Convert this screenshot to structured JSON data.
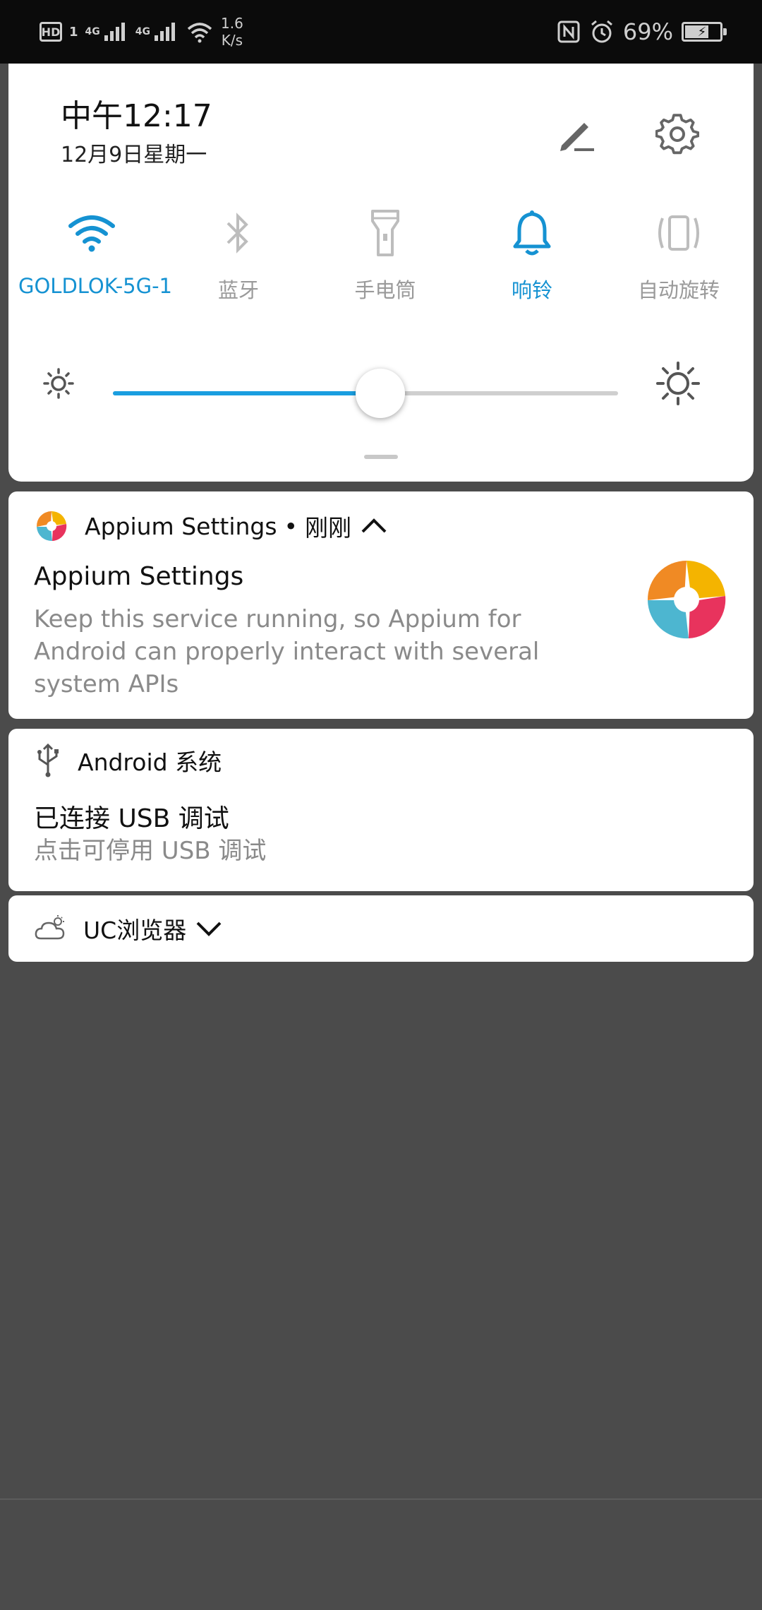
{
  "status_bar": {
    "hd": "HD",
    "sim": "1",
    "net1": "4G",
    "net2": "4G",
    "speed_value": "1.6",
    "speed_unit": "K/s",
    "battery_percent": "69%",
    "battery_level": 0.69
  },
  "quick_settings": {
    "time": "中午12:17",
    "date": "12月9日星期一",
    "tiles": [
      {
        "label": "GOLDLOK-5G-1",
        "icon": "wifi-icon",
        "active": true
      },
      {
        "label": "蓝牙",
        "icon": "bluetooth-icon",
        "active": false
      },
      {
        "label": "手电筒",
        "icon": "flashlight-icon",
        "active": false
      },
      {
        "label": "响铃",
        "icon": "bell-icon",
        "active": true
      },
      {
        "label": "自动旋转",
        "icon": "auto-rotate-icon",
        "active": false
      }
    ],
    "brightness_level": 0.53
  },
  "notifications": [
    {
      "app": "Appium Settings",
      "time": "刚刚",
      "title": "Appium Settings",
      "body": "Keep this service running, so Appium for Android can properly interact with several system APIs",
      "body_lines": [
        "Keep this service running, so Appium for",
        "Android can properly interact with several",
        "system APIs"
      ],
      "icon": "appium-logo-icon"
    },
    {
      "app": "Android 系统",
      "title": "已连接 USB 调试",
      "body": "点击可停用 USB 调试",
      "icon": "usb-icon"
    },
    {
      "app": "UC浏览器",
      "icon": "weather-cloud-icon"
    }
  ],
  "colors": {
    "accent": "#1592d2",
    "inactive": "#9a9a9a",
    "background": "#4b4b4b"
  }
}
